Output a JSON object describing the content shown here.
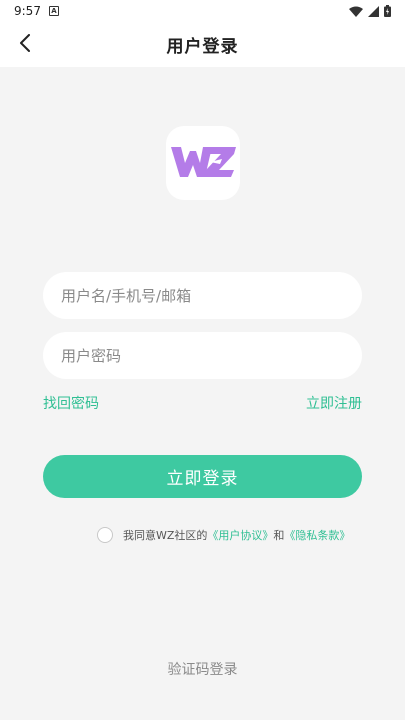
{
  "status_bar": {
    "time": "9:57",
    "notification_icon": "a-notification-icon",
    "wifi_icon": "wifi-icon",
    "signal_icon": "cell-signal-icon",
    "battery_icon": "battery-charging-icon"
  },
  "header": {
    "title": "用户登录",
    "back_icon": "chevron-left-icon"
  },
  "logo": {
    "text": "WZ",
    "color": "#b47ce8"
  },
  "form": {
    "username_placeholder": "用户名/手机号/邮箱",
    "username_value": "",
    "password_placeholder": "用户密码",
    "password_value": "",
    "forgot_password": "找回密码",
    "register_now": "立即注册",
    "login_button": "立即登录"
  },
  "agreement": {
    "checked": false,
    "prefix": "我同意WZ社区的",
    "user_agreement": "《用户协议》",
    "conjunction": "和",
    "privacy_policy": "《隐私条款》"
  },
  "footer": {
    "sms_login": "验证码登录"
  },
  "colors": {
    "accent": "#3ec9a1",
    "link": "#2fbf93",
    "background": "#f4f4f4",
    "logo_purple": "#b47ce8"
  }
}
